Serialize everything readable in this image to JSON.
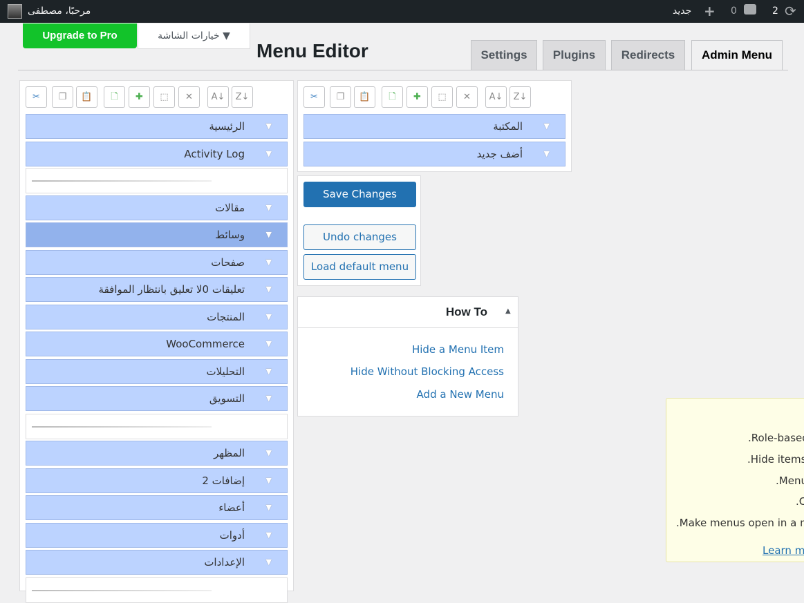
{
  "topbar": {
    "greeting": "مرحبًا، مصطفى",
    "new_label": "جديد",
    "comments_count": "0",
    "updates_count": "2"
  },
  "header": {
    "upgrade_label": "Upgrade to Pro",
    "screen_options_label": "خيارات الشاشة ▼",
    "title": "Menu Editor"
  },
  "tabs": [
    {
      "label": "Settings"
    },
    {
      "label": "Plugins"
    },
    {
      "label": "Redirects"
    },
    {
      "label": "Admin Menu",
      "active": true
    }
  ],
  "toolbar_icons": [
    "cut-icon",
    "copy-icon",
    "paste-icon",
    "new-menu-icon",
    "new-separator-icon",
    "toggle-hidden-icon",
    "delete-icon",
    "sort-ascending-icon",
    "sort-descending-icon"
  ],
  "menu_items": [
    "الرئيسية",
    "Activity Log",
    "",
    "مقالات",
    "وسائط",
    "صفحات",
    "تعليقات 0لا تعليق بانتظار الموافقة",
    "المنتجات",
    "WooCommerce",
    "التحليلات",
    "التسويق",
    "",
    "المظهر",
    "إضافات 2",
    "أعضاء",
    "أدوات",
    "الإعدادات",
    ""
  ],
  "selected_item": "وسائط",
  "submenu_items": [
    "المكتبة",
    "أضف جديد"
  ],
  "actions": {
    "save": "Save Changes",
    "undo": "Undo changes",
    "load_default": "Load default menu"
  },
  "howto": {
    "title": "How To",
    "links": [
      "Hide a Menu Item",
      "Hide Without Blocking Access",
      "Add a New Menu"
    ]
  },
  "notice": {
    "lines": [
      ".Role-based",
      ".Hide items",
      ".Menu",
      ".C",
      ".Make menus open in a ne"
    ],
    "link": "Learn m"
  }
}
